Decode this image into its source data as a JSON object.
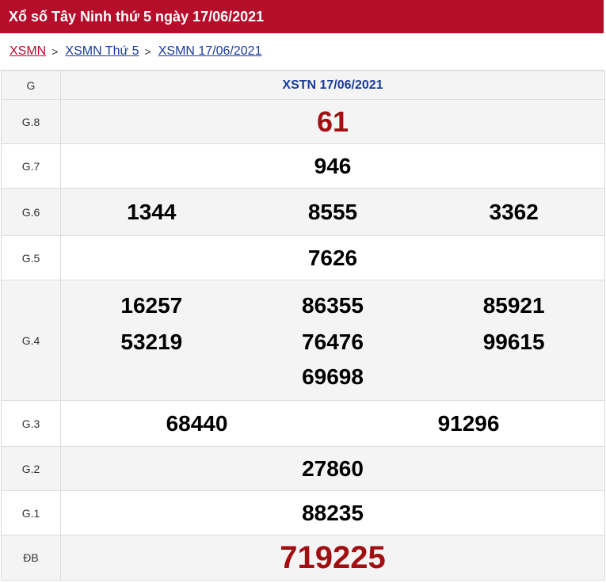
{
  "header": {
    "title": "Xổ số Tây Ninh thứ 5 ngày 17/06/2021"
  },
  "breadcrumb": [
    "XSMN",
    "XSMN Thứ 5",
    "XSMN 17/06/2021"
  ],
  "table": {
    "col_g": "G",
    "col_title": "XSTN 17/06/2021",
    "prizes": [
      {
        "label": "G.8",
        "numbers": [
          "61"
        ]
      },
      {
        "label": "G.7",
        "numbers": [
          "946"
        ]
      },
      {
        "label": "G.6",
        "numbers": [
          "1344",
          "8555",
          "3362"
        ]
      },
      {
        "label": "G.5",
        "numbers": [
          "7626"
        ]
      },
      {
        "label": "G.4",
        "numbers": [
          "16257",
          "86355",
          "85921",
          "53219",
          "76476",
          "99615",
          "69698"
        ]
      },
      {
        "label": "G.3",
        "numbers": [
          "68440",
          "91296"
        ]
      },
      {
        "label": "G.2",
        "numbers": [
          "27860"
        ]
      },
      {
        "label": "G.1",
        "numbers": [
          "88235"
        ]
      },
      {
        "label": "ĐB",
        "numbers": [
          "719225"
        ]
      }
    ]
  },
  "colors": {
    "brand": "#b50d2a",
    "link": "#1a3c9c",
    "special": "#a10f12"
  }
}
